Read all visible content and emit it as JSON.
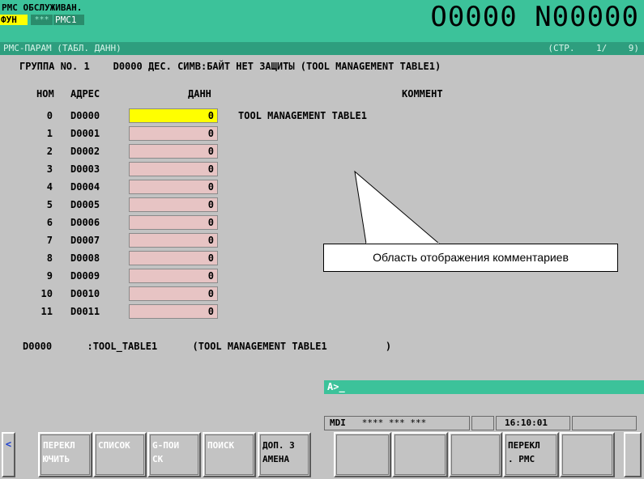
{
  "header": {
    "title": "PMC ОБСЛУЖИВАН.",
    "fun_label": "ФУН",
    "stars": "***",
    "pmc_label": "PMC1",
    "program_number": "O0000 N00000"
  },
  "titlebar": {
    "left": "PMC-ПАРАМ (ТАБЛ. ДАНН)",
    "right": "(СТР.    1/    9)"
  },
  "group_line": "ГРУППА NO. 1    D0000 ДЕС. СИМВ:БАЙТ НЕТ ЗАЩИТЫ (TOOL MANAGEMENT TABLE1)",
  "columns": {
    "num": "НОМ",
    "address": "АДРЕС",
    "data": "ДАНН",
    "comment": "КОММЕНТ"
  },
  "rows": [
    {
      "num": "0",
      "address": "D0000",
      "value": "0",
      "comment": "TOOL MANAGEMENT TABLE1"
    },
    {
      "num": "1",
      "address": "D0001",
      "value": "0"
    },
    {
      "num": "2",
      "address": "D0002",
      "value": "0"
    },
    {
      "num": "3",
      "address": "D0003",
      "value": "0"
    },
    {
      "num": "4",
      "address": "D0004",
      "value": "0"
    },
    {
      "num": "5",
      "address": "D0005",
      "value": "0"
    },
    {
      "num": "6",
      "address": "D0006",
      "value": "0"
    },
    {
      "num": "7",
      "address": "D0007",
      "value": "0"
    },
    {
      "num": "8",
      "address": "D0008",
      "value": "0"
    },
    {
      "num": "9",
      "address": "D0009",
      "value": "0"
    },
    {
      "num": "10",
      "address": "D0010",
      "value": "0"
    },
    {
      "num": "11",
      "address": "D0011",
      "value": "0"
    }
  ],
  "callout": "Область отображения комментариев",
  "bottom_line": "D0000      :TOOL_TABLE1      (TOOL MANAGEMENT TABLE1          )",
  "input_line": "A>_",
  "status": {
    "mode": "MDI",
    "stars": "**** *** ***",
    "time": "16:10:01"
  },
  "softkeys": {
    "left_arrow": "<",
    "switch": "ПЕРЕКЛ\nЮЧИТЬ",
    "list": "СПИСОК",
    "g_search": "G-ПОИ\nСК",
    "search": "ПОИСК",
    "extra_replace": "ДОП. З\nАМЕНА",
    "switch_pmc": "ПЕРЕКЛ\n. PMC"
  }
}
